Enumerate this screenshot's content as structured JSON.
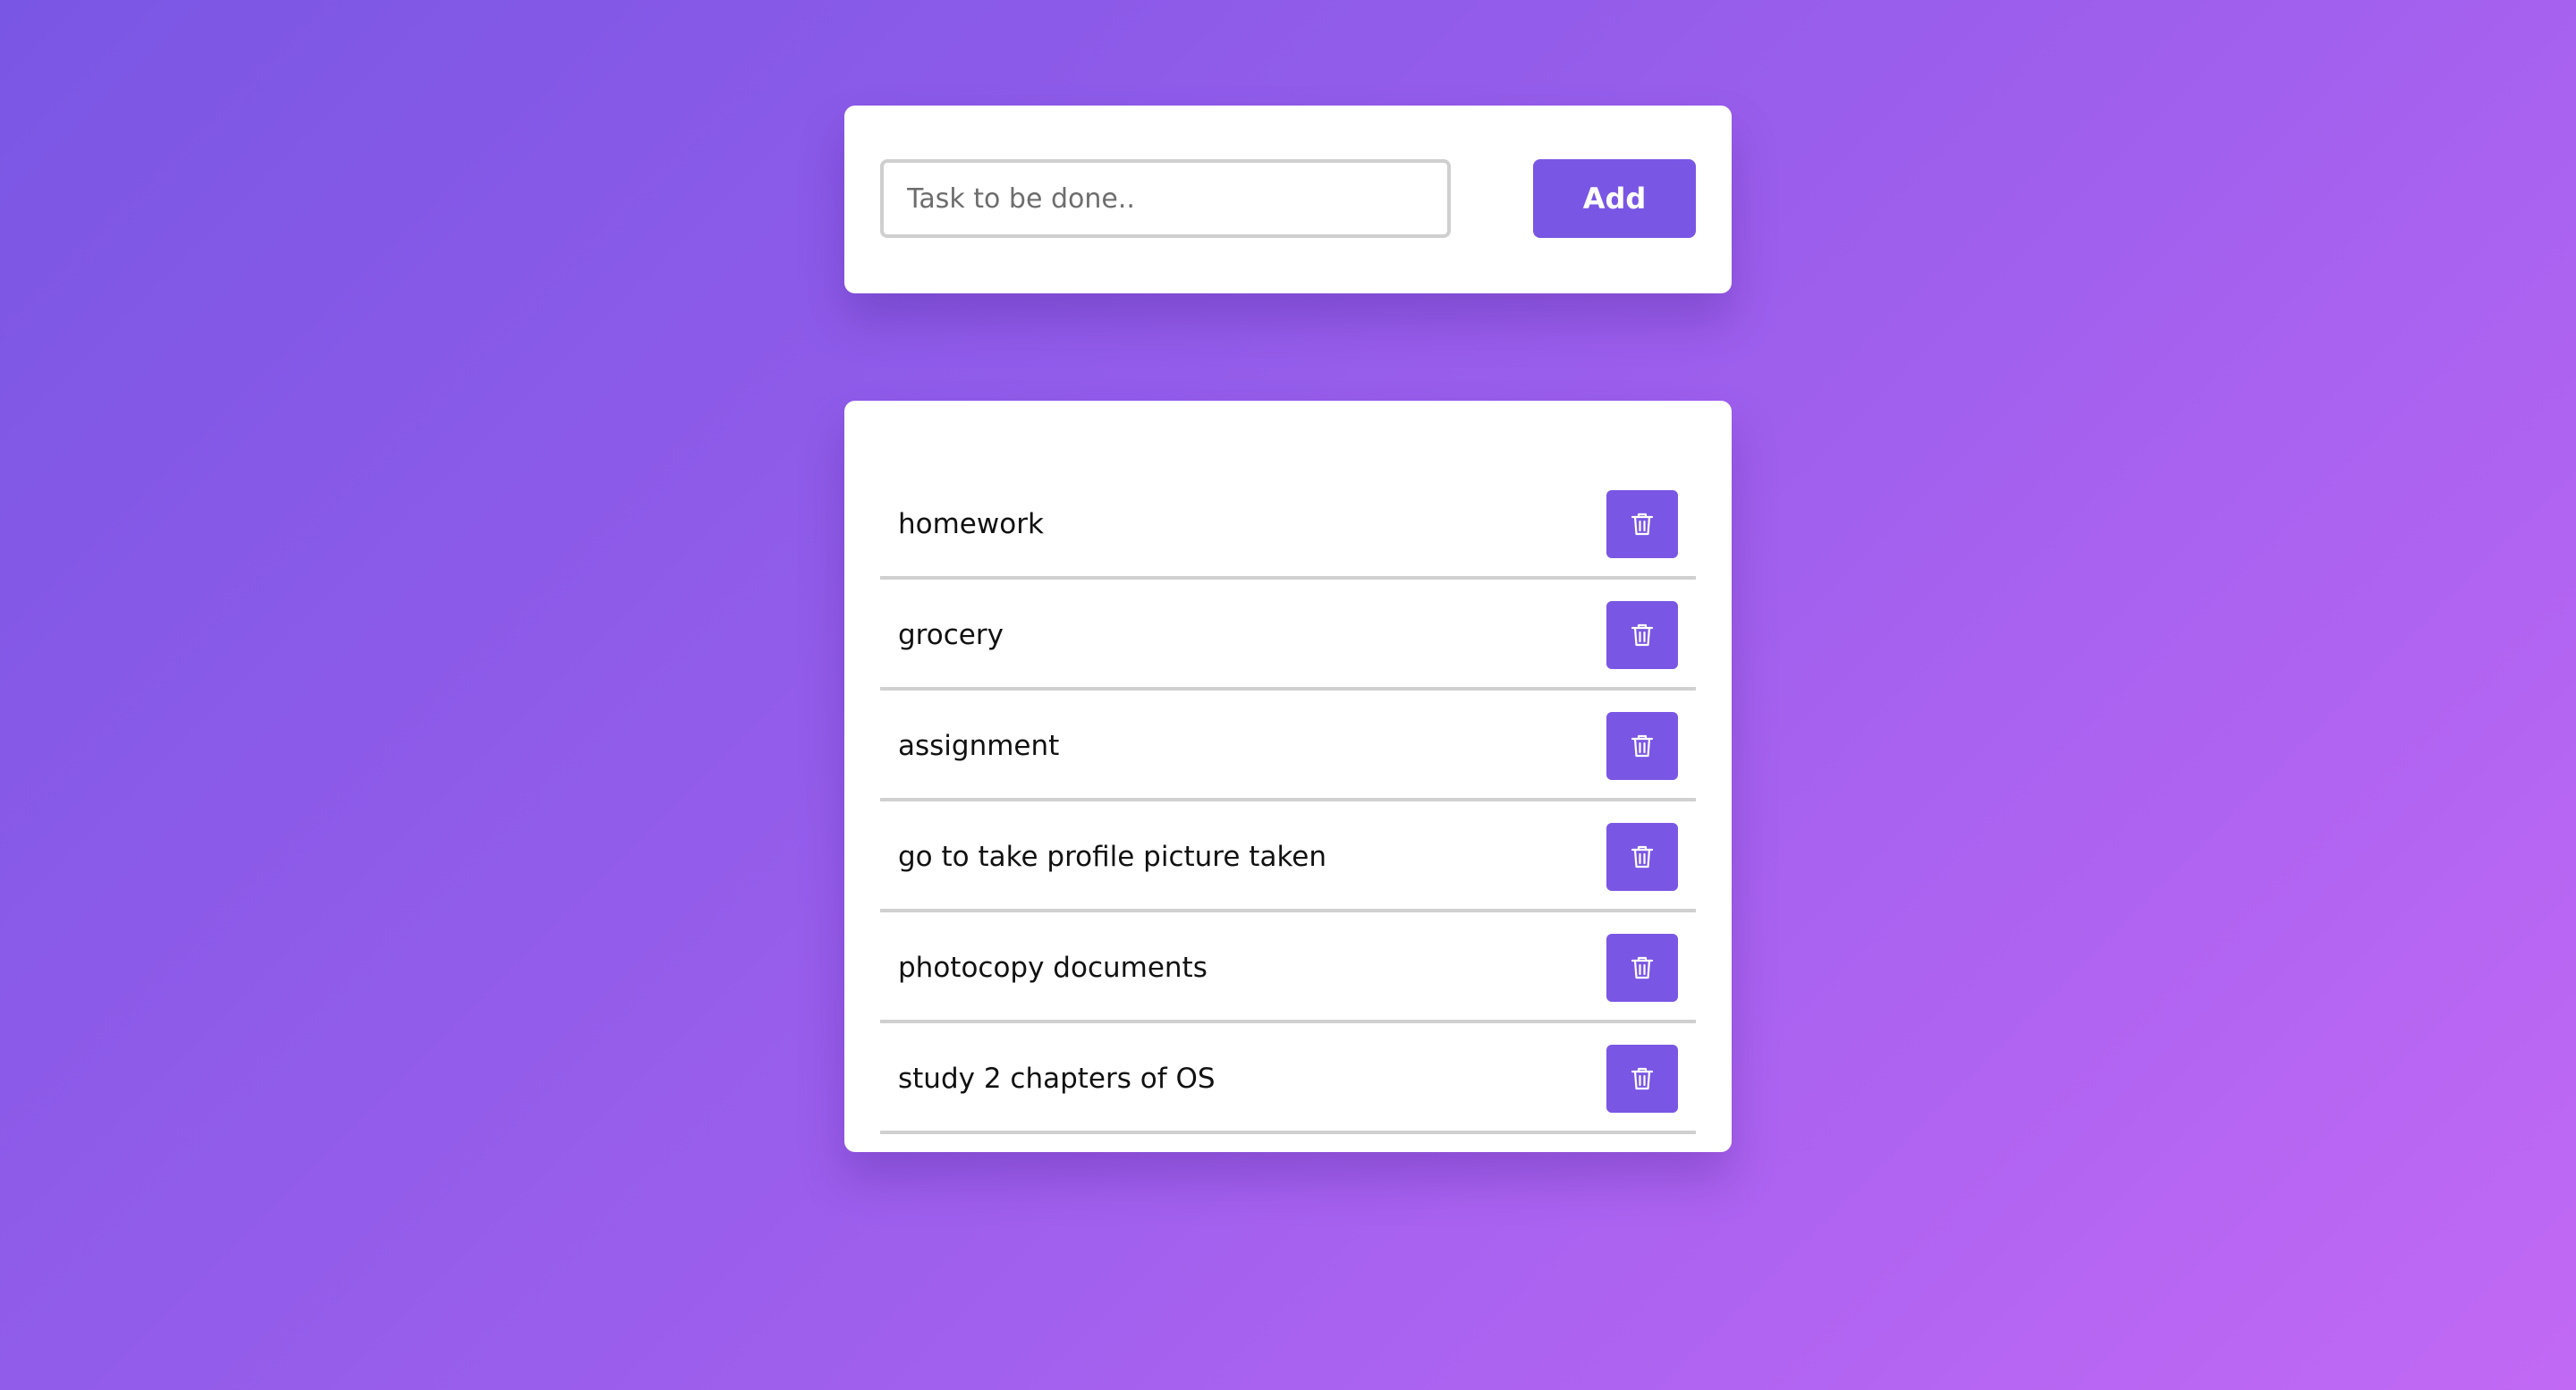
{
  "input_section": {
    "placeholder": "Task to be done..",
    "value": "",
    "add_label": "Add"
  },
  "tasks": [
    {
      "text": "homework",
      "action_icon": "trash-icon"
    },
    {
      "text": "grocery",
      "action_icon": "trash-icon"
    },
    {
      "text": "assignment",
      "action_icon": "trash-icon"
    },
    {
      "text": "go to take profile picture taken",
      "action_icon": "trash-icon"
    },
    {
      "text": "photocopy documents",
      "action_icon": "trash-icon"
    },
    {
      "text": "study 2 chapters of OS",
      "action_icon": "trash-icon"
    }
  ],
  "colors": {
    "accent": "#7a56e4",
    "background_start": "#7a56e4",
    "background_end": "#c169f5",
    "card": "#ffffff",
    "divider": "#d0d0d0"
  }
}
